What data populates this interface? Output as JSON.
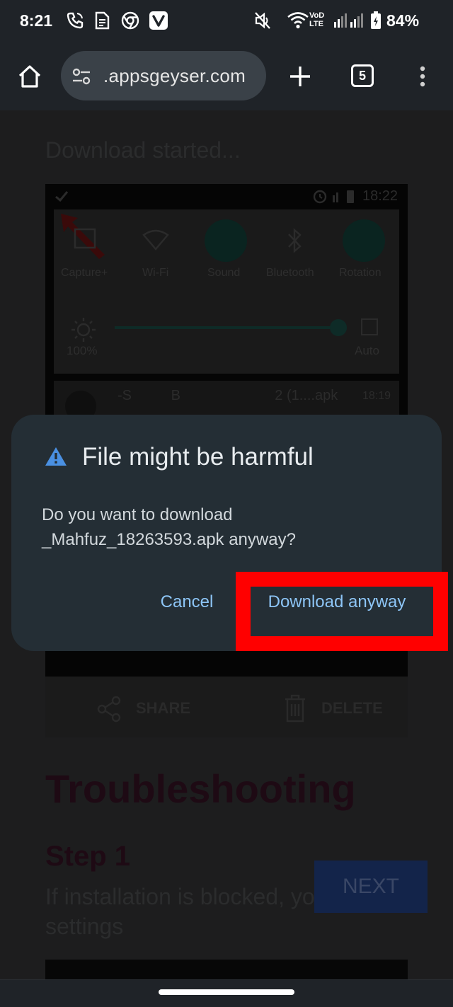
{
  "status_bar": {
    "time": "8:21",
    "battery": "84%",
    "icons": [
      "call-icon",
      "document-icon",
      "chrome-icon",
      "vivaldi-icon",
      "mute-icon",
      "wifi-icon",
      "volte-icon",
      "signal-icon",
      "battery-icon"
    ],
    "volte_top": "VoD",
    "volte_bottom": "LTE"
  },
  "toolbar": {
    "url": ".appsgeyser.com",
    "tab_count": "5"
  },
  "page": {
    "heading": "Download started...",
    "screenshot": {
      "time": "18:22",
      "quick_settings": [
        "Capture+",
        "Wi-Fi",
        "Sound",
        "Bluetooth",
        "Rotation"
      ],
      "brightness": "100%",
      "auto_label": "Auto",
      "notification_name": "-S          B                        2 (1....apk",
      "notification_time": "18:19"
    },
    "share_label": "SHARE",
    "delete_label": "DELETE",
    "troubleshooting": "Troubleshooting",
    "step_title": "Step 1",
    "step_text": "If installation is blocked, your settings",
    "next_label": "NEXT"
  },
  "dialog": {
    "title": "File might be harmful",
    "body": "Do you want to download _Mahfuz_18263593.apk anyway?",
    "cancel_label": "Cancel",
    "download_label": "Download anyway",
    "warning_color": "#4a90e2",
    "accent_color": "#8dc5f6"
  },
  "annotation": {
    "highlight_color": "#ff0000"
  }
}
